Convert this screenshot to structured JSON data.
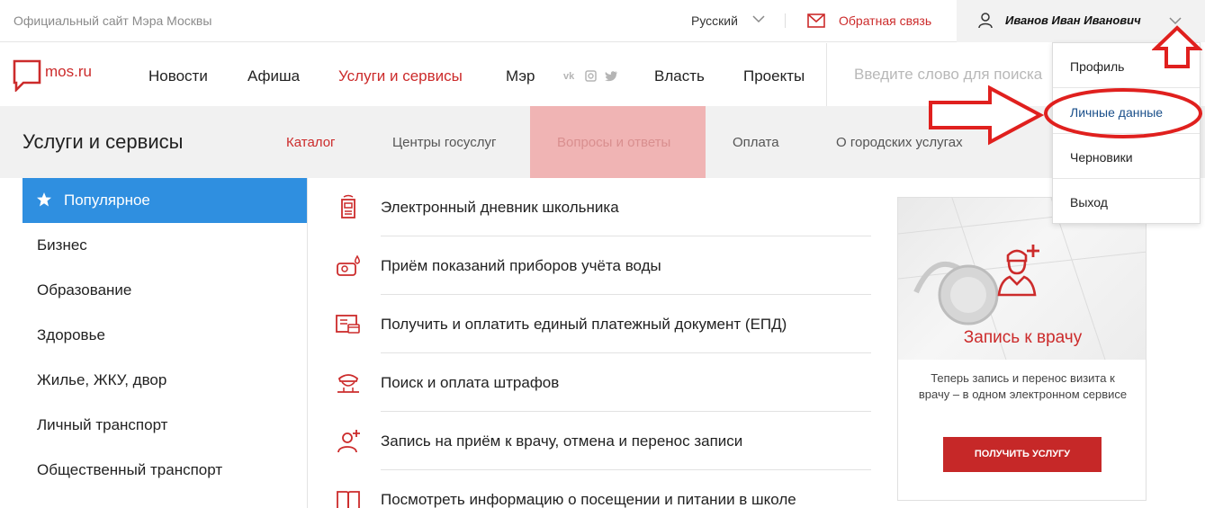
{
  "topbar": {
    "official_text": "Официальный сайт Мэра Москвы",
    "language": "Русский",
    "feedback": "Обратная связь",
    "user_name": "Иванов Иван Иванович"
  },
  "nav": {
    "logo_text": "mos.ru",
    "items": [
      "Новости",
      "Афиша",
      "Услуги и сервисы",
      "Мэр",
      "Власть",
      "Проекты"
    ],
    "active_item": "Услуги и сервисы",
    "search_placeholder": "Введите слово для поиска"
  },
  "section": {
    "title": "Услуги и сервисы",
    "tabs": [
      "Каталог",
      "Центры госуслуг",
      "Вопросы и ответы",
      "Оплата",
      "О городских услугах"
    ],
    "active_tab": "Каталог",
    "highlighted_tab": "Вопросы и ответы"
  },
  "sidebar": {
    "active": "Популярное",
    "items": [
      "Бизнес",
      "Образование",
      "Здоровье",
      "Жилье, ЖКУ, двор",
      "Личный транспорт",
      "Общественный транспорт"
    ]
  },
  "services": [
    {
      "label": "Электронный дневник школьника",
      "icon": "school-diary-icon"
    },
    {
      "label": "Приём показаний приборов учёта воды",
      "icon": "water-meter-icon"
    },
    {
      "label": "Получить и оплатить единый платежный документ (ЕПД)",
      "icon": "payment-document-icon"
    },
    {
      "label": "Поиск и оплата штрафов",
      "icon": "police-fines-icon"
    },
    {
      "label": "Запись на приём к врачу, отмена и перенос записи",
      "icon": "doctor-icon"
    },
    {
      "label": "Посмотреть информацию о посещении и питании в школе",
      "icon": "school-book-icon"
    }
  ],
  "promo": {
    "title": "Запись к врачу",
    "description": "Теперь запись и перенос визита к врачу – в одном электронном сервисе",
    "button": "ПОЛУЧИТЬ УСЛУГУ"
  },
  "dropdown": {
    "items": [
      "Профиль",
      "Личные данные",
      "Черновики",
      "Выход"
    ],
    "highlighted": "Личные данные"
  },
  "colors": {
    "brand_red": "#cc2b2b",
    "active_blue": "#2f8fe0",
    "highlight_pink": "#f0b4b4",
    "annotation_red": "#e0201e"
  }
}
